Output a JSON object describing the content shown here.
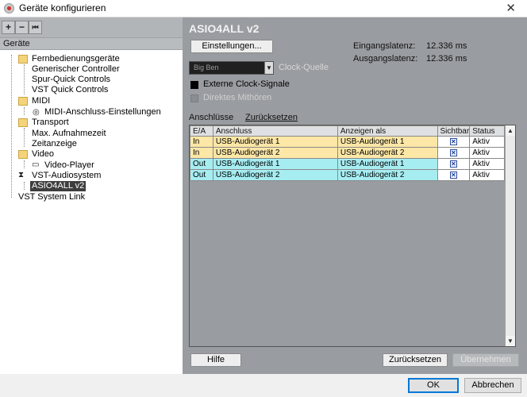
{
  "window": {
    "title": "Geräte konfigurieren",
    "close_glyph": "✕"
  },
  "toolbar": {
    "add": "+",
    "remove": "−",
    "reset": "⏮"
  },
  "left": {
    "header": "Geräte",
    "tree": [
      {
        "label": "Fernbedienungsgeräte",
        "icon": "folder-icon"
      },
      {
        "label": "Generischer Controller"
      },
      {
        "label": "Spur-Quick Controls"
      },
      {
        "label": "VST Quick Controls"
      },
      {
        "label": "MIDI",
        "icon": "folder-icon"
      },
      {
        "label": "MIDI-Anschluss-Einstellungen",
        "icon": "midi-port-icon"
      },
      {
        "label": "Transport",
        "icon": "folder-icon"
      },
      {
        "label": "Max. Aufnahmezeit"
      },
      {
        "label": "Zeitanzeige"
      },
      {
        "label": "Video",
        "icon": "folder-icon"
      },
      {
        "label": "Video-Player",
        "icon": "video-player-icon"
      },
      {
        "label": "VST-Audiosystem",
        "icon": "audio-system-icon"
      },
      {
        "label": "ASIO4ALL v2",
        "selected": true
      },
      {
        "label": "VST System Link"
      }
    ]
  },
  "right": {
    "title": "ASIO4ALL v2",
    "settings_button": "Einstellungen...",
    "input_latency_label": "Eingangslatenz:",
    "input_latency_value": "12.336 ms",
    "output_latency_label": "Ausgangslatenz:",
    "output_latency_value": "12.336 ms",
    "clock_select_value": "Big Ben",
    "clock_source_label": "Clock-Quelle",
    "external_clock_label": "Externe Clock-Signale",
    "external_clock_checked": true,
    "direct_monitor_label": "Direktes Mithören",
    "direct_monitor_enabled": false,
    "connections_label": "Anschlüsse",
    "reset_link": "Zurücksetzen",
    "table": {
      "headers": [
        "E/A",
        "Anschluss",
        "Anzeigen als",
        "Sichtbar",
        "Status"
      ],
      "rows": [
        {
          "io": "In",
          "port": "USB-Audiogerät 1",
          "show_as": "USB-Audiogerät 1",
          "visible": "✕",
          "status": "Aktiv"
        },
        {
          "io": "In",
          "port": "USB-Audiogerät 2",
          "show_as": "USB-Audiogerät 2",
          "visible": "✕",
          "status": "Aktiv"
        },
        {
          "io": "Out",
          "port": "USB-Audiogerät 1",
          "show_as": "USB-Audiogerät 1",
          "visible": "✕",
          "status": "Aktiv"
        },
        {
          "io": "Out",
          "port": "USB-Audiogerät 2",
          "show_as": "USB-Audiogerät 2",
          "visible": "✕",
          "status": "Aktiv"
        }
      ]
    },
    "help_button": "Hilfe",
    "reset_button": "Zurücksetzen",
    "apply_button": "Übernehmen"
  },
  "footer": {
    "ok": "OK",
    "cancel": "Abbrechen"
  },
  "colors": {
    "in_row": "#fde7a6",
    "out_row": "#a6edf2",
    "selected_node": "#3e3e3e",
    "panel_bg": "#999ca0"
  }
}
